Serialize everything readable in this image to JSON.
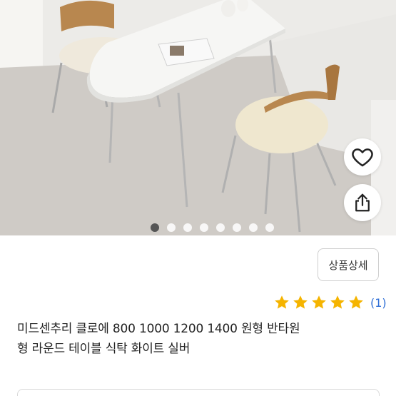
{
  "photo": {
    "dots_total": 8,
    "dots_active_index": 0,
    "like_icon": "heart-icon",
    "share_icon": "share-icon"
  },
  "detail_button": {
    "label": "상품상세"
  },
  "rating": {
    "stars": 5,
    "count_label": "(1)",
    "star_color": "#f5b400"
  },
  "product": {
    "title": "미드센추리 클로에 800 1000 1200 1400 원형 반타원\n형 라운드 테이블 식탁 화이트 실버"
  }
}
